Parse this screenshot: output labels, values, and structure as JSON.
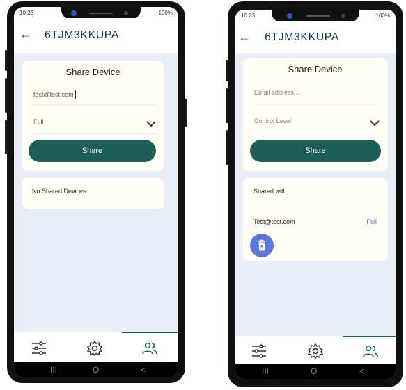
{
  "left": {
    "status": {
      "time": "10:23",
      "right": "100%"
    },
    "device_name": "6TJM3KKUPA",
    "card_title": "Share Device",
    "email_value": "test@test.com",
    "control_value": "Full",
    "share_label": "Share",
    "no_devices": "No Shared Devices",
    "nav": {
      "recent": "III",
      "home": "O",
      "back": "<"
    }
  },
  "right": {
    "status": {
      "time": "10:23",
      "right": "100%"
    },
    "device_name": "6TJM3KKUPA",
    "card_title": "Share Device",
    "email_placeholder": "Email address...",
    "control_placeholder": "Control Level",
    "share_label": "Share",
    "shared_with": "Shared with",
    "shared_email": "Test@test.com",
    "shared_level": "Full",
    "nav": {
      "recent": "III",
      "home": "O",
      "back": "<"
    }
  },
  "colors": {
    "primary": "#1d5f56",
    "accent": "#5b78d6",
    "link": "#2f6db5",
    "background": "#e9eef6"
  },
  "icons": {
    "back": "arrow-left-icon",
    "settings": "sliders-icon",
    "gear": "gear-icon",
    "users": "users-icon",
    "trash": "trash-icon",
    "chevron": "chevron-down-icon"
  }
}
